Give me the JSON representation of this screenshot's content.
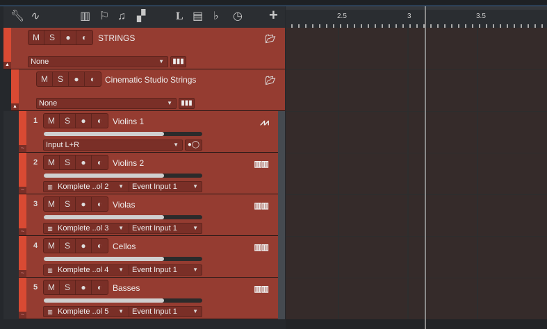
{
  "toolbar": {
    "icons": [
      "wrench-icon",
      "automation-icon",
      "inspector-icon",
      "marker-icon",
      "chord-icon",
      "arranger-icon",
      "lyrics-icon",
      "video-icon",
      "tempo-icon",
      "clock-icon",
      "add-icon"
    ],
    "lyrics_label": "L",
    "add_label": "+"
  },
  "ruler": {
    "labels": [
      "2.5",
      "3",
      "3.5"
    ]
  },
  "folders": [
    {
      "name": "STRINGS",
      "mute": "M",
      "solo": "S",
      "dropdown": "None"
    },
    {
      "name": "Cinematic Studio Strings",
      "mute": "M",
      "solo": "S",
      "dropdown": "None"
    }
  ],
  "tracks": [
    {
      "number": "1",
      "name": "Violins 1",
      "mute": "M",
      "solo": "S",
      "type": "audio",
      "input": "Input L+R",
      "volume": 0.76
    },
    {
      "number": "2",
      "name": "Violins 2",
      "mute": "M",
      "solo": "S",
      "type": "instrument",
      "instrument": "Komplete ..ol 2",
      "input": "Event Input 1",
      "volume": 0.76
    },
    {
      "number": "3",
      "name": "Violas",
      "mute": "M",
      "solo": "S",
      "type": "instrument",
      "instrument": "Komplete ..ol 3",
      "input": "Event Input 1",
      "volume": 0.76
    },
    {
      "number": "4",
      "name": "Cellos",
      "mute": "M",
      "solo": "S",
      "type": "instrument",
      "instrument": "Komplete ..ol 4",
      "input": "Event Input 1",
      "volume": 0.76
    },
    {
      "number": "5",
      "name": "Basses",
      "mute": "M",
      "solo": "S",
      "type": "instrument",
      "instrument": "Komplete ..ol 5",
      "input": "Event Input 1",
      "volume": 0.76
    }
  ],
  "colors": {
    "track": "#953c31",
    "strip": "#d94a33",
    "timeline": "#352b2a"
  }
}
